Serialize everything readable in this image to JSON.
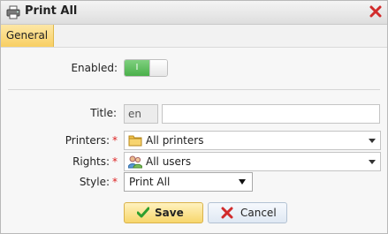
{
  "window": {
    "title": "Print All"
  },
  "tabs": [
    {
      "label": "General",
      "active": true
    }
  ],
  "form": {
    "enabled": {
      "label": "Enabled:",
      "state_text": "I",
      "on": true
    },
    "title": {
      "label": "Title:",
      "lang": "en",
      "value": ""
    },
    "printers": {
      "label": "Printers:",
      "required_mark": "*",
      "value": "All printers",
      "icon": "folder-icon"
    },
    "rights": {
      "label": "Rights:",
      "required_mark": "*",
      "value": "All users",
      "icon": "users-icon"
    },
    "style": {
      "label": "Style:",
      "required_mark": "*",
      "value": "Print All"
    }
  },
  "buttons": {
    "save": "Save",
    "cancel": "Cancel"
  },
  "colors": {
    "accent_tab": "#f8cf63",
    "toggle_on": "#4ab04a",
    "required": "#dd2222",
    "save_button": "#f7d66c",
    "cancel_button": "#dfe8f3"
  }
}
